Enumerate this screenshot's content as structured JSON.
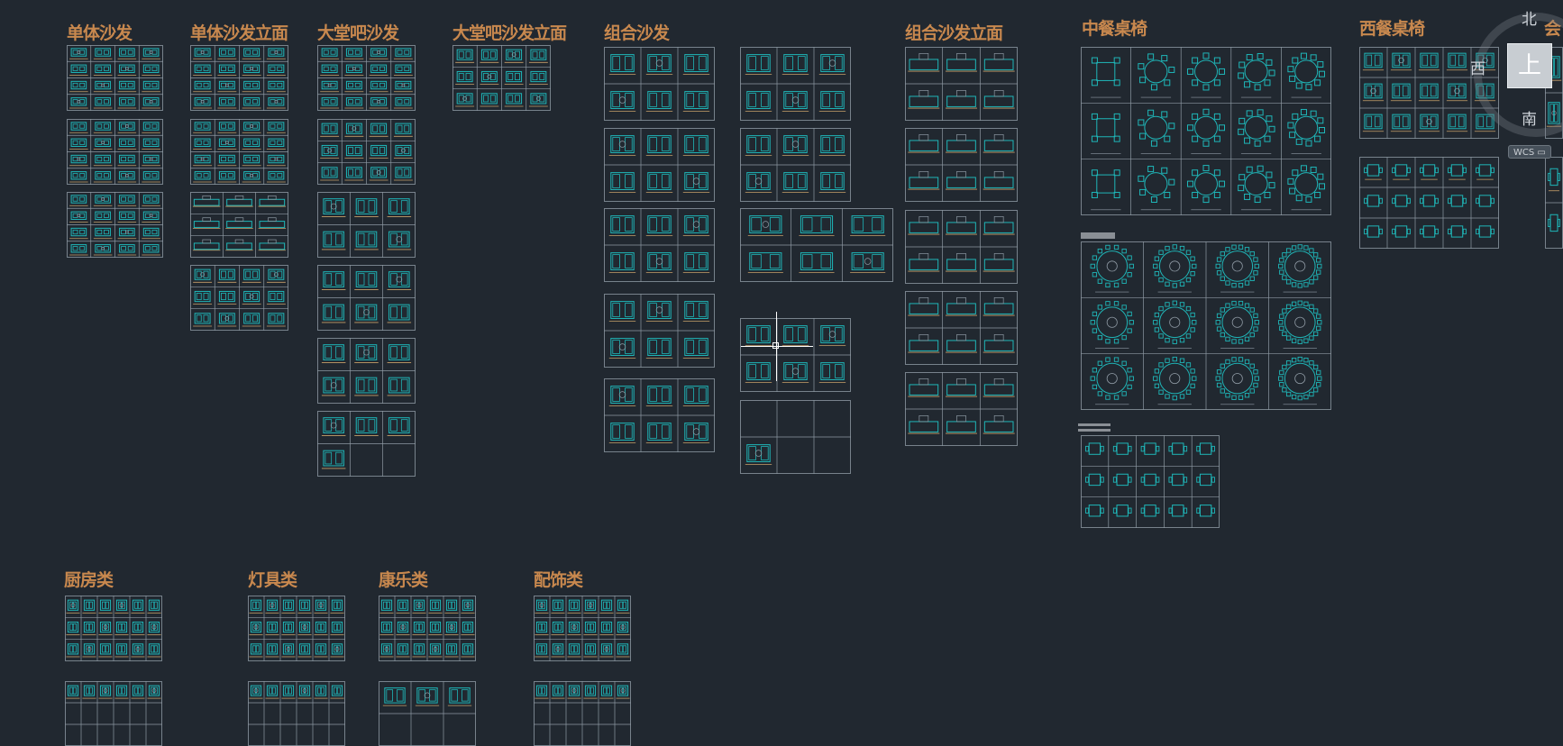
{
  "canvas": {
    "background": "#212830",
    "grid_color": "#8e99a3",
    "symbol_color": "#1fb6b8",
    "accent_color": "#c7a06a",
    "title_color": "#c8884e"
  },
  "titles": {
    "single_sofa": "单体沙发",
    "single_sofa_elev": "单体沙发立面",
    "lobby_sofa": "大堂吧沙发",
    "lobby_sofa_elev": "大堂吧沙发立面",
    "combo_sofa": "组合沙发",
    "combo_sofa_elev": "组合沙发立面",
    "chinese_dining": "中餐桌椅",
    "western_dining": "西餐桌椅",
    "meeting_partial": "会",
    "kitchen": "厨房类",
    "lighting": "灯具类",
    "recreation": "康乐类",
    "decor": "配饰类"
  },
  "viewcube": {
    "north": "北",
    "west": "西",
    "south": "南",
    "face": "上",
    "wcs": "WCS ▭"
  }
}
